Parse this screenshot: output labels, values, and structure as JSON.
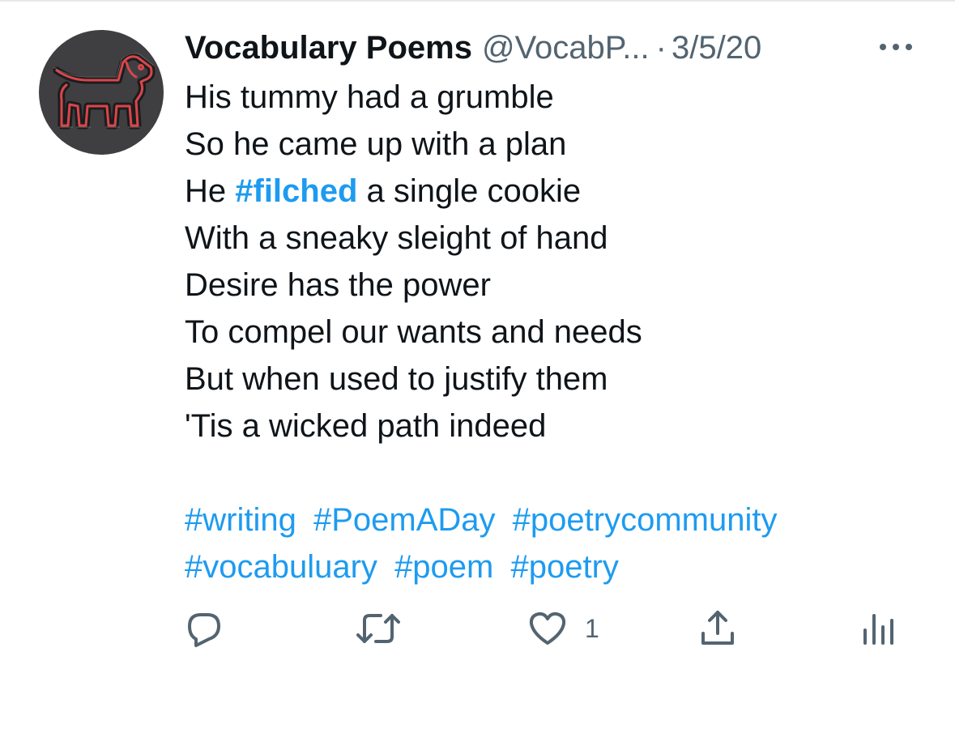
{
  "tweet": {
    "display_name": "Vocabulary Poems",
    "handle": "@VocabP...",
    "separator": "·",
    "date": "3/5/20",
    "lines": {
      "l1": "His tummy had a grumble",
      "l2": "So he came up with a plan",
      "l3_before": "He ",
      "l3_hashtag": "#filched",
      "l3_after": " a single cookie",
      "l4": "With a sneaky sleight of hand",
      "l5": "Desire has the power",
      "l6": "To compel our wants and needs",
      "l7": "But when used to justify them",
      "l8": "'Tis a wicked path indeed"
    },
    "hashtags": [
      "#writing",
      "#PoemADay",
      "#poetrycommunity",
      "#vocabuluary",
      "#poem",
      "#poetry"
    ]
  },
  "actions": {
    "reply": {
      "icon": "reply-icon"
    },
    "retweet": {
      "icon": "retweet-icon"
    },
    "like": {
      "icon": "heart-icon",
      "count": "1"
    },
    "share": {
      "icon": "share-icon"
    },
    "analytics": {
      "icon": "analytics-icon"
    }
  },
  "colors": {
    "text": "#0f1419",
    "secondary": "#536471",
    "link": "#1d9bf0",
    "avatar_bg": "#3f3f42",
    "avatar_line": "#d9464a"
  }
}
